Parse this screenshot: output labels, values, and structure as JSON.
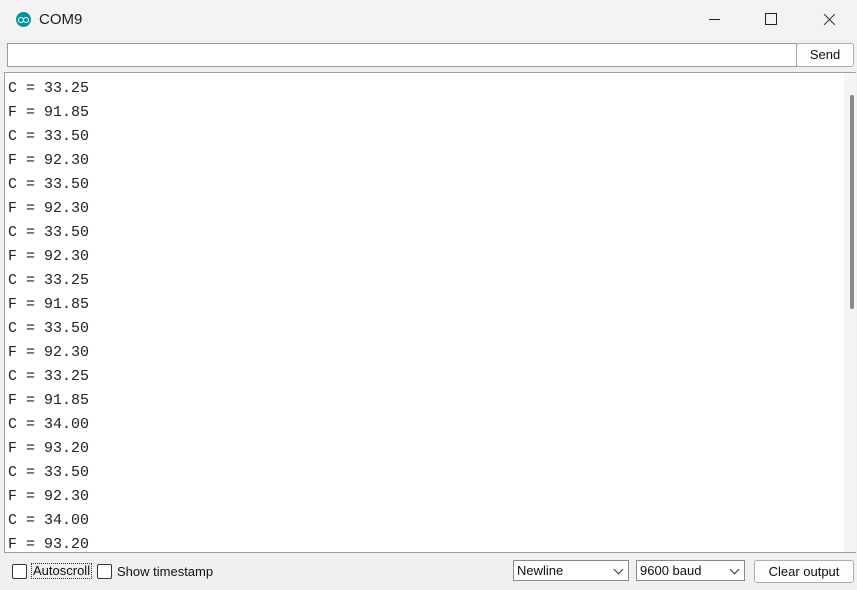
{
  "window": {
    "title": "COM9"
  },
  "input": {
    "value": "",
    "send_label": "Send"
  },
  "output": {
    "lines": [
      "C = 33.25",
      "F = 91.85",
      "C = 33.50",
      "F = 92.30",
      "C = 33.50",
      "F = 92.30",
      "C = 33.50",
      "F = 92.30",
      "C = 33.25",
      "F = 91.85",
      "C = 33.50",
      "F = 92.30",
      "C = 33.25",
      "F = 91.85",
      "C = 34.00",
      "F = 93.20",
      "C = 33.50",
      "F = 92.30",
      "C = 34.00",
      "F = 93.20"
    ]
  },
  "footer": {
    "autoscroll_label": "Autoscroll",
    "timestamp_label": "Show timestamp",
    "line_ending": "Newline",
    "baud_rate": "9600 baud",
    "clear_label": "Clear output"
  },
  "icons": {
    "app": "arduino-logo-icon",
    "minimize": "minimize-icon",
    "maximize": "maximize-icon",
    "close": "close-icon"
  },
  "colors": {
    "accent": "#00979c"
  }
}
